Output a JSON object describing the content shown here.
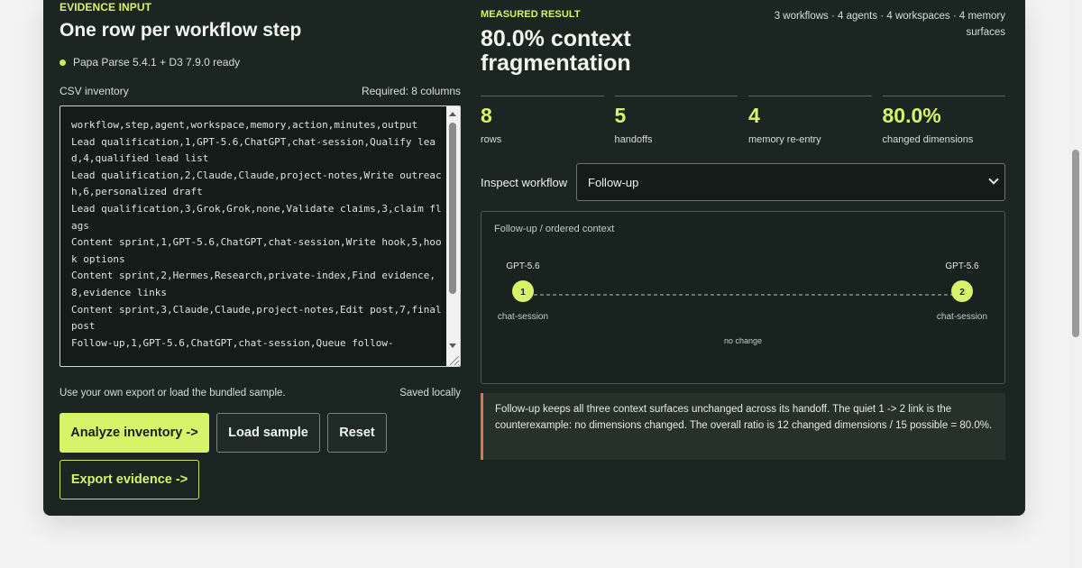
{
  "left": {
    "eyebrow": "EVIDENCE INPUT",
    "title": "One row per workflow step",
    "status": "Papa Parse 5.4.1 + D3 7.9.0 ready",
    "csv_label": "CSV inventory",
    "csv_required": "Required: 8 columns",
    "csv_text": "workflow,step,agent,workspace,memory,action,minutes,output\nLead qualification,1,GPT-5.6,ChatGPT,chat-session,Qualify lead,4,qualified lead list\nLead qualification,2,Claude,Claude,project-notes,Write outreach,6,personalized draft\nLead qualification,3,Grok,Grok,none,Validate claims,3,claim flags\nContent sprint,1,GPT-5.6,ChatGPT,chat-session,Write hook,5,hook options\nContent sprint,2,Hermes,Research,private-index,Find evidence,8,evidence links\nContent sprint,3,Claude,Claude,project-notes,Edit post,7,final post\nFollow-up,1,GPT-5.6,ChatGPT,chat-session,Queue follow-",
    "hint": "Use your own export or load the bundled sample.",
    "saved": "Saved locally",
    "buttons": {
      "analyze": "Analyze inventory ->",
      "load": "Load sample",
      "reset": "Reset",
      "export": "Export evidence ->"
    }
  },
  "right": {
    "eyebrow": "MEASURED RESULT",
    "title": "80.0% context fragmentation",
    "meta": "3 workflows · 4 agents · 4 workspaces · 4 memory surfaces",
    "stats": [
      {
        "value": "8",
        "label": "rows"
      },
      {
        "value": "5",
        "label": "handoffs"
      },
      {
        "value": "4",
        "label": "memory re-entry"
      },
      {
        "value": "80.0%",
        "label": "changed dimensions"
      }
    ],
    "inspect_label": "Inspect workflow",
    "selected_workflow": "Follow-up",
    "viz": {
      "title": "Follow-up / ordered context",
      "steps": [
        {
          "step": "1",
          "agent": "GPT-5.6",
          "memory": "chat-session"
        },
        {
          "step": "2",
          "agent": "GPT-5.6",
          "memory": "chat-session"
        }
      ],
      "link_label": "no change"
    },
    "callout": "Follow-up keeps all three context surfaces unchanged across its handoff. The quiet 1 -> 2 link is the counterexample: no dimensions changed. The overall ratio is 12 changed dimensions / 15 possible = 80.0%."
  },
  "colors": {
    "panel": "#1b2622",
    "accent": "#d7f36a",
    "callout_border": "#e2735b"
  }
}
